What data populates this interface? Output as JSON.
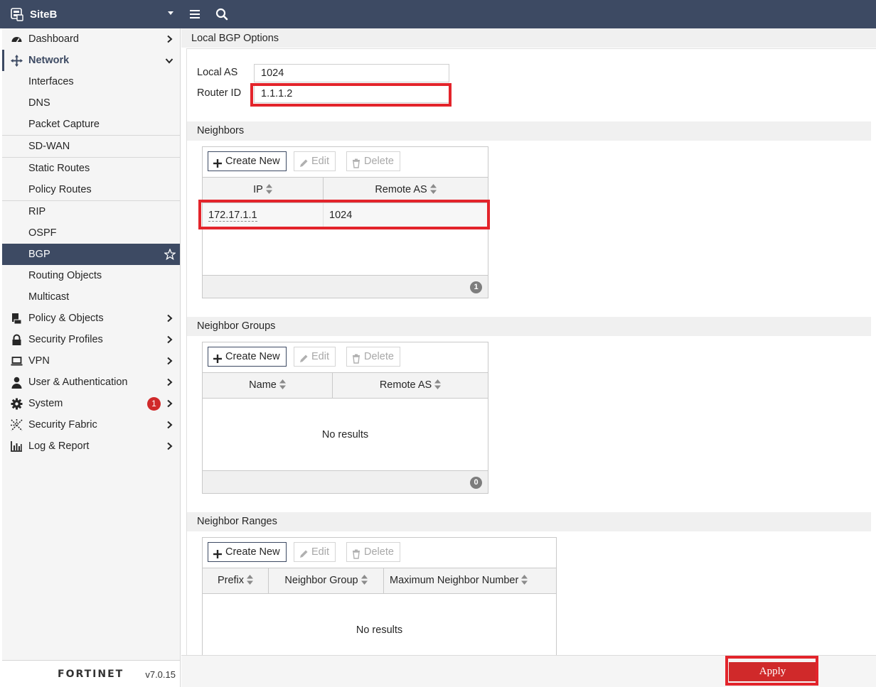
{
  "header": {
    "device_name": "SiteB"
  },
  "sidebar": {
    "items": [
      {
        "label": "Dashboard",
        "icon": "dashboard-icon"
      },
      {
        "label": "Network",
        "icon": "network-icon"
      },
      {
        "label": "Policy & Objects",
        "icon": "policy-icon"
      },
      {
        "label": "Security Profiles",
        "icon": "lock-icon"
      },
      {
        "label": "VPN",
        "icon": "laptop-icon"
      },
      {
        "label": "User & Authentication",
        "icon": "user-icon"
      },
      {
        "label": "System",
        "icon": "gear-icon",
        "badge": "1"
      },
      {
        "label": "Security Fabric",
        "icon": "fabric-icon"
      },
      {
        "label": "Log & Report",
        "icon": "chart-icon"
      }
    ],
    "network_sub": [
      "Interfaces",
      "DNS",
      "Packet Capture",
      "SD-WAN",
      "Static Routes",
      "Policy Routes",
      "RIP",
      "OSPF",
      "BGP",
      "Routing Objects",
      "Multicast"
    ],
    "logo_text": "FORTINET",
    "version": "v7.0.15"
  },
  "page": {
    "title": "Local BGP Options",
    "local_as_label": "Local AS",
    "local_as_value": "1024",
    "router_id_label": "Router ID",
    "router_id_value": "1.1.1.2"
  },
  "toolbar": {
    "create_new": "Create New",
    "edit": "Edit",
    "delete": "Delete"
  },
  "neighbors": {
    "title": "Neighbors",
    "columns": [
      "IP",
      "Remote AS"
    ],
    "rows": [
      {
        "ip": "172.17.1.1",
        "remote_as": "1024"
      }
    ],
    "count": "1"
  },
  "neighbor_groups": {
    "title": "Neighbor Groups",
    "columns": [
      "Name",
      "Remote AS"
    ],
    "empty_text": "No results",
    "count": "0"
  },
  "neighbor_ranges": {
    "title": "Neighbor Ranges",
    "columns": [
      "Prefix",
      "Neighbor Group",
      "Maximum Neighbor Number"
    ],
    "empty_text": "No results"
  },
  "footer": {
    "apply_label": "Apply"
  },
  "colors": {
    "topbar": "#3d4a63",
    "highlight": "#e3242b",
    "apply": "#d0292a"
  }
}
